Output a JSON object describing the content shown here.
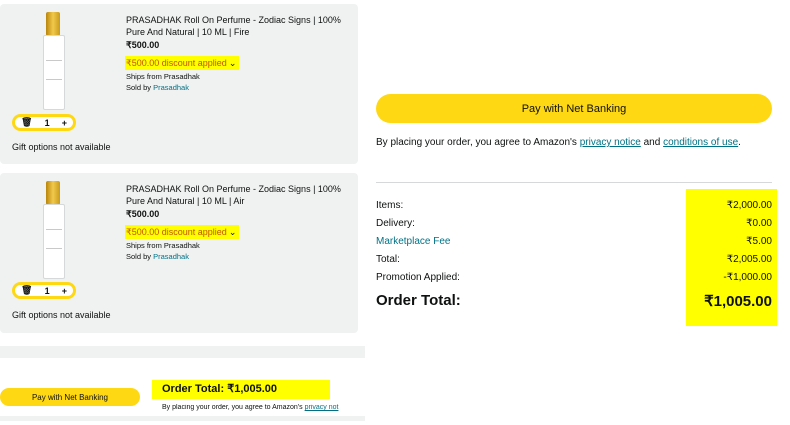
{
  "items": [
    {
      "title": "PRASADHAK Roll On Perfume - Zodiac Signs | 100% Pure And Natural | 10 ML | Fire",
      "price": "₹500.00",
      "discount": "₹500.00 discount applied",
      "ships_from_label": "Ships from Prasadhak",
      "sold_by_label": "Sold by",
      "sold_by": "Prasadhak",
      "quantity": "1",
      "gift": "Gift options not available"
    },
    {
      "title": "PRASADHAK Roll On Perfume - Zodiac Signs | 100% Pure And Natural | 10 ML | Air",
      "price": "₹500.00",
      "discount": "₹500.00 discount applied",
      "ships_from_label": "Ships from Prasadhak",
      "sold_by_label": "Sold by",
      "sold_by": "Prasadhak",
      "quantity": "1",
      "gift": "Gift options not available"
    }
  ],
  "bottom": {
    "pay_button": "Pay with Net Banking",
    "order_total_label": "Order Total:",
    "order_total_value": "₹1,005.00",
    "agree_text": "By placing your order, you agree to Amazon's",
    "privacy_link": "privacy not"
  },
  "summary": {
    "pay_button": "Pay with Net Banking",
    "agree_prefix": "By placing your order, you agree to Amazon's",
    "privacy_link": "privacy notice",
    "and": "and",
    "conditions_link": "conditions of use",
    "period": ".",
    "rows": [
      {
        "label": "Items:",
        "value": "₹2,000.00"
      },
      {
        "label": "Delivery:",
        "value": "₹0.00"
      },
      {
        "label": "Marketplace Fee",
        "value": "₹5.00"
      },
      {
        "label": "Total:",
        "value": "₹2,005.00"
      },
      {
        "label": "Promotion Applied:",
        "value": "-₹1,000.00"
      }
    ],
    "grand_label": "Order Total:",
    "grand_value": "₹1,005.00"
  },
  "colors": {
    "button_yellow": "#ffd814",
    "highlight": "#ffff00",
    "link": "#007185",
    "card_bg": "#f0f2f2"
  }
}
